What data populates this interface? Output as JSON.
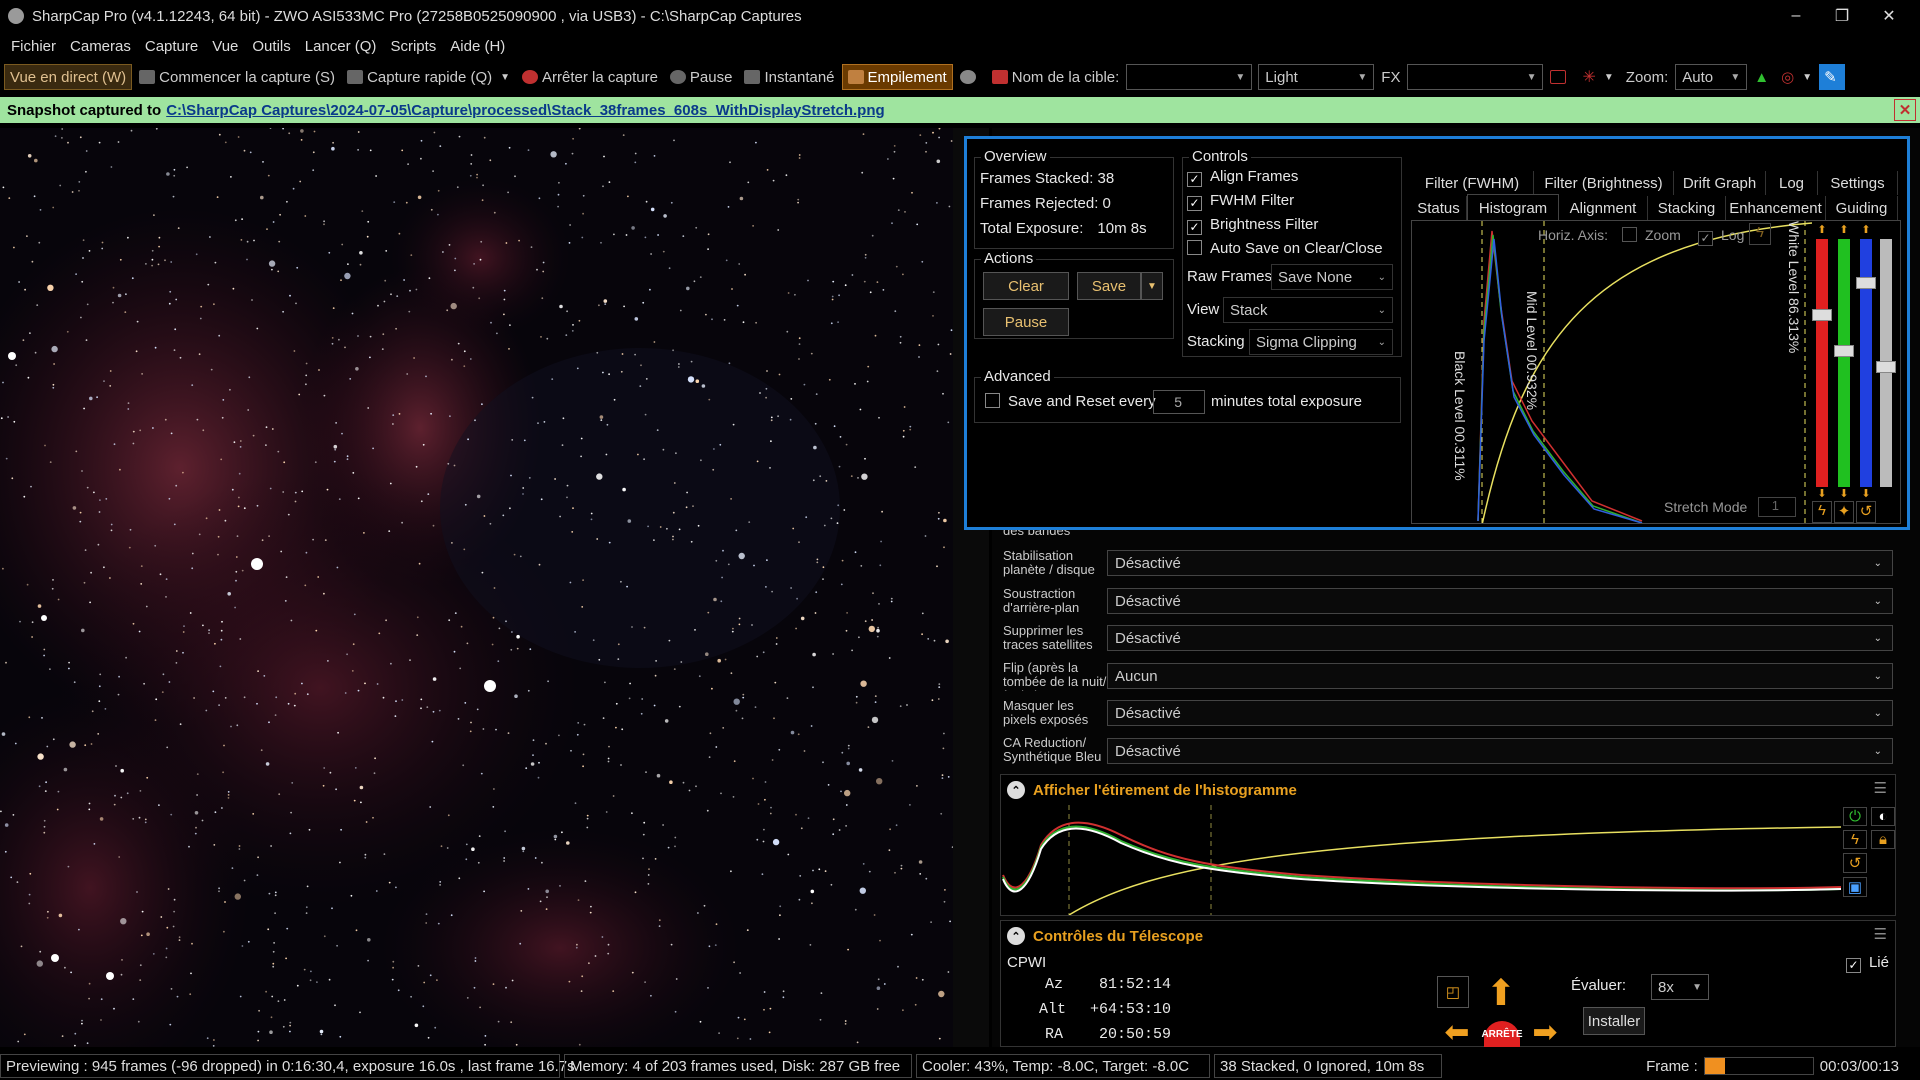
{
  "titlebar": {
    "title": "SharpCap Pro (v4.1.12243, 64 bit) - ZWO ASI533MC Pro (27258B0525090900 , via USB3) - C:\\SharpCap Captures",
    "minimize": "–",
    "maximize": "❐",
    "close": "✕"
  },
  "menu": [
    "Fichier",
    "Cameras",
    "Capture",
    "Vue",
    "Outils",
    "Lancer (Q)",
    "Scripts",
    "Aide (H)"
  ],
  "toolbar": {
    "live": "Vue en direct (W)",
    "start_capture": "Commencer la capture (S)",
    "quick_capture": "Capture rapide (Q)",
    "stop_capture": "Arrêter la capture",
    "pause": "Pause",
    "snapshot": "Instantané",
    "stacking": "Empilement",
    "target_label": "Nom de la cible:",
    "target_value": "",
    "frame_type": "Light",
    "fx_label": "FX",
    "fx_value": "",
    "zoom_label": "Zoom:",
    "zoom_value": "Auto"
  },
  "notification": {
    "prefix": "Snapshot captured to",
    "path": "C:\\SharpCap Captures\\2024-07-05\\Capture\\processed\\Stack_38frames_608s_WithDisplayStretch.png",
    "close": "✕"
  },
  "stack": {
    "overview": {
      "title": "Overview",
      "frames_stacked_label": "Frames Stacked:",
      "frames_stacked": "38",
      "frames_rejected_label": "Frames Rejected:",
      "frames_rejected": "0",
      "total_exposure_label": "Total Exposure:",
      "total_exposure": "10m 8s"
    },
    "actions": {
      "title": "Actions",
      "clear": "Clear",
      "save": "Save",
      "pause": "Pause"
    },
    "advanced": {
      "title": "Advanced",
      "save_reset": "Save and Reset every",
      "minutes_value": "5",
      "minutes_suffix": "minutes total exposure"
    },
    "controls": {
      "title": "Controls",
      "align": "Align Frames",
      "fwhm": "FWHM Filter",
      "brightness": "Brightness Filter",
      "autosave": "Auto Save on Clear/Close",
      "raw_label": "Raw Frames",
      "raw_value": "Save None",
      "view_label": "View",
      "view_value": "Stack",
      "stacking_label": "Stacking",
      "stacking_value": "Sigma Clipping"
    },
    "tabs_top": [
      "Filter (FWHM)",
      "Filter (Brightness)",
      "Drift Graph",
      "Log",
      "Settings"
    ],
    "tabs_bottom": [
      "Status",
      "Histogram",
      "Alignment",
      "Stacking",
      "Enhancement",
      "Guiding"
    ],
    "histogram": {
      "horiz_axis": "Horiz. Axis:",
      "zoom": "Zoom",
      "log": "Log",
      "black_level": "Black Level 00.311%",
      "mid_level": "Mid Level 00.932%",
      "white_level": "White Level 86.313%",
      "stretch_mode": "Stretch Mode",
      "stretch_value": "1"
    }
  },
  "right_controls": [
    {
      "label": "des bandes",
      "value": ""
    },
    {
      "label": "Stabilisation planète / disque",
      "value": "Désactivé"
    },
    {
      "label": "Soustraction d'arrière-plan",
      "value": "Désactivé"
    },
    {
      "label": "Supprimer les traces satellites",
      "value": "Désactivé"
    },
    {
      "label": "Flip (après la tombée de la nuit/à plat)",
      "value": "Aucun"
    },
    {
      "label": "Masquer les pixels exposés",
      "value": "Désactivé"
    },
    {
      "label": "CA Reduction/ Synthétique Bleu",
      "value": "Désactivé"
    }
  ],
  "histo_stretch": {
    "title": "Afficher l'étirement de l'histogramme"
  },
  "telescope": {
    "title": "Contrôles du Télescope",
    "name": "CPWI",
    "linked": "Lié",
    "az_label": "Az",
    "az": "81:52:14",
    "alt_label": "Alt",
    "alt": "+64:53:10",
    "ra_label": "RA",
    "ra": "20:50:59",
    "rate_label": "Évaluer:",
    "rate_value": "8x",
    "install": "Installer",
    "stop": "ARRÊTE"
  },
  "status": {
    "preview": "Previewing : 945 frames (-96 dropped) in 0:16:30,4, exposure 16.0s , last frame 16.7s",
    "memory": "Memory: 4 of 203 frames used, Disk: 287 GB free",
    "cooler": "Cooler: 43%, Temp: -8.0C, Target: -8.0C",
    "stacked": "38 Stacked, 0 Ignored, 10m 8s",
    "frame_label": "Frame :",
    "time": "00:03/00:13"
  },
  "colors": {
    "accent": "#1e7fd8",
    "notif_bg": "#9fe49f",
    "gold": "#e8c070",
    "histo_red": "#d03030",
    "histo_green": "#30b030",
    "histo_blue": "#3060e0",
    "curve": "#e8e060"
  }
}
